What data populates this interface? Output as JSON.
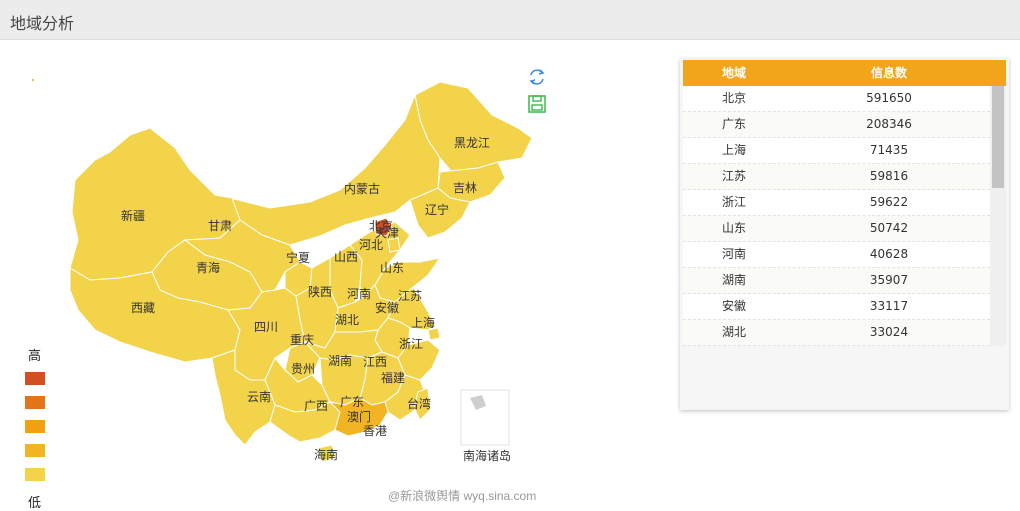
{
  "header": {
    "title": "地域分析"
  },
  "toolbar": {
    "refresh_icon": "refresh-icon",
    "save_icon": "save-icon"
  },
  "colors": {
    "scale": [
      "#d24f22",
      "#e4741a",
      "#f29f11",
      "#f2b422",
      "#f2d34a"
    ],
    "header_orange": "#f2a51b",
    "icon_blue": "#3a8ee6",
    "icon_green": "#3cb84a"
  },
  "legend": {
    "high": "高",
    "low": "低"
  },
  "map": {
    "labels": [
      {
        "name": "黑龙江",
        "level": 4
      },
      {
        "name": "吉林",
        "level": 4
      },
      {
        "name": "辽宁",
        "level": 4
      },
      {
        "name": "内蒙古",
        "level": 4
      },
      {
        "name": "北京",
        "level": 0
      },
      {
        "name": "天津",
        "level": 4
      },
      {
        "name": "河北",
        "level": 4
      },
      {
        "name": "山西",
        "level": 4
      },
      {
        "name": "山东",
        "level": 4
      },
      {
        "name": "新疆",
        "level": 4
      },
      {
        "name": "甘肃",
        "level": 4
      },
      {
        "name": "青海",
        "level": 4
      },
      {
        "name": "宁夏",
        "level": 4
      },
      {
        "name": "陕西",
        "level": 4
      },
      {
        "name": "河南",
        "level": 4
      },
      {
        "name": "江苏",
        "level": 4
      },
      {
        "name": "安徽",
        "level": 4
      },
      {
        "name": "上海",
        "level": 4
      },
      {
        "name": "西藏",
        "level": 4
      },
      {
        "name": "四川",
        "level": 4
      },
      {
        "name": "湖北",
        "level": 4
      },
      {
        "name": "重庆",
        "level": 4
      },
      {
        "name": "浙江",
        "level": 4
      },
      {
        "name": "湖南",
        "level": 4
      },
      {
        "name": "江西",
        "level": 4
      },
      {
        "name": "贵州",
        "level": 4
      },
      {
        "name": "福建",
        "level": 4
      },
      {
        "name": "云南",
        "level": 4
      },
      {
        "name": "广西",
        "level": 4
      },
      {
        "name": "广东",
        "level": 3
      },
      {
        "name": "澳门",
        "level": 4
      },
      {
        "name": "台湾",
        "level": 4
      },
      {
        "name": "香港",
        "level": 4
      },
      {
        "name": "海南",
        "level": 4
      },
      {
        "name": "南海诸岛",
        "level": 4
      }
    ]
  },
  "watermark": "@新浪微舆情 wyq.sina.com",
  "table": {
    "headers": [
      "地域",
      "信息数"
    ],
    "rows": [
      [
        "北京",
        "591650"
      ],
      [
        "广东",
        "208346"
      ],
      [
        "上海",
        "71435"
      ],
      [
        "江苏",
        "59816"
      ],
      [
        "浙江",
        "59622"
      ],
      [
        "山东",
        "50742"
      ],
      [
        "河南",
        "40628"
      ],
      [
        "湖南",
        "35907"
      ],
      [
        "安徽",
        "33117"
      ],
      [
        "湖北",
        "33024"
      ]
    ]
  }
}
